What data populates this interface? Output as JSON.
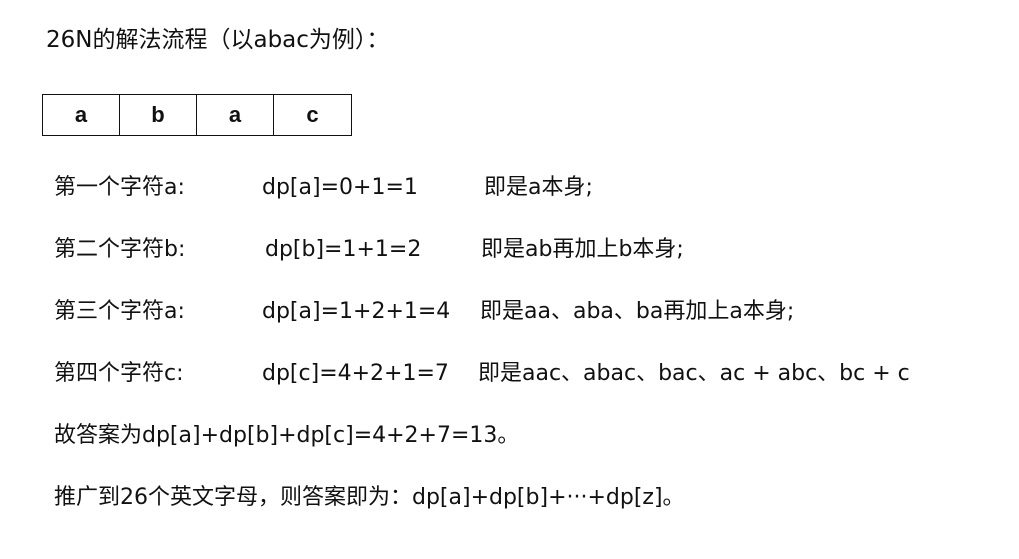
{
  "title": "26N的解法流程（以abac为例）：",
  "chars": [
    "a",
    "b",
    "a",
    "c"
  ],
  "steps": [
    {
      "label": "第一个字符a:",
      "formula": "dp[a]=0+1=1",
      "desc": "即是a本身;"
    },
    {
      "label": "第二个字符b:",
      "formula": "dp[b]=1+1=2",
      "desc": "即是ab再加上b本身;"
    },
    {
      "label": "第三个字符a:",
      "formula": "dp[a]=1+2+1=4",
      "desc": "即是aa、aba、ba再加上a本身;"
    },
    {
      "label": "第四个字符c:",
      "formula": "dp[c]=4+2+1=7",
      "desc": "即是aac、abac、bac、ac  +  abc、bc + c"
    }
  ],
  "answer": "故答案为dp[a]+dp[b]+dp[c]=4+2+7=13。",
  "generalize": "推广到26个英文字母，则答案即为：dp[a]+dp[b]+···+dp[z]。"
}
